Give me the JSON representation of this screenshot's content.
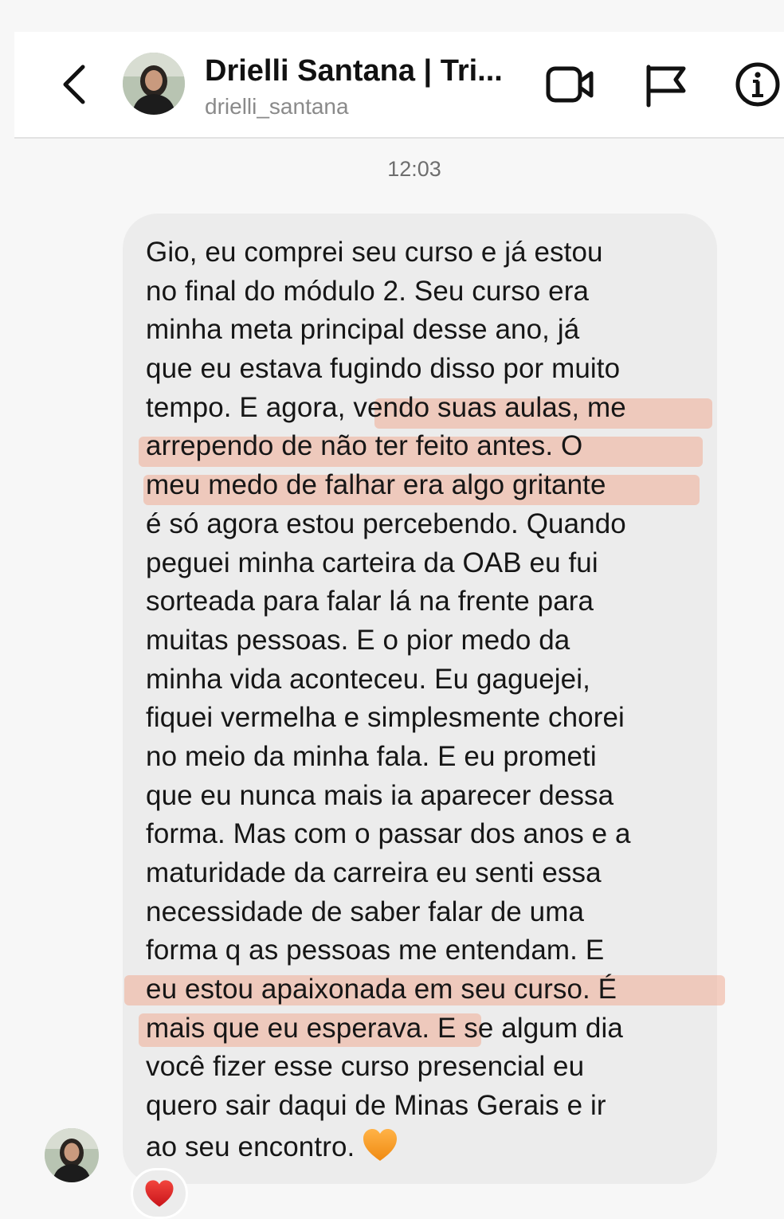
{
  "header": {
    "back_icon": "chevron-left-icon",
    "name": "Drielli Santana | Tri...",
    "username": "drielli_santana",
    "icons": [
      "video-camera-icon",
      "flag-icon",
      "info-icon"
    ]
  },
  "timestamp": "12:03",
  "message": {
    "lines": [
      "Gio, eu comprei seu curso e já estou",
      "no final do módulo 2. Seu curso era",
      "minha meta principal desse ano, já",
      "que eu estava fugindo disso por muito",
      "tempo. E agora, vendo suas aulas, me",
      "arrependo de não ter feito antes. O",
      "meu medo de falhar era algo gritante",
      "é só agora estou percebendo. Quando",
      "peguei minha carteira da OAB eu fui",
      "sorteada para falar lá na frente para",
      "muitas pessoas. E o pior medo da",
      "minha vida aconteceu. Eu gaguejei,",
      "fiquei vermelha e simplesmente chorei",
      "no meio da minha fala. E eu prometi",
      "que eu nunca mais ia aparecer dessa",
      "forma. Mas com o passar dos anos e a",
      "maturidade da carreira eu senti essa",
      "necessidade de saber falar de uma",
      "forma q as pessoas me entendam. E",
      "eu estou apaixonada em seu curso. É",
      "mais que eu esperava. E se algum dia",
      "você fizer esse curso presencial eu",
      "quero sair daqui de Minas Gerais e ir",
      "ao seu encontro."
    ],
    "end_emoji": "orange-heart-icon",
    "highlight_color": "#f0ad96"
  },
  "reaction": {
    "emoji": "red-heart-icon"
  }
}
